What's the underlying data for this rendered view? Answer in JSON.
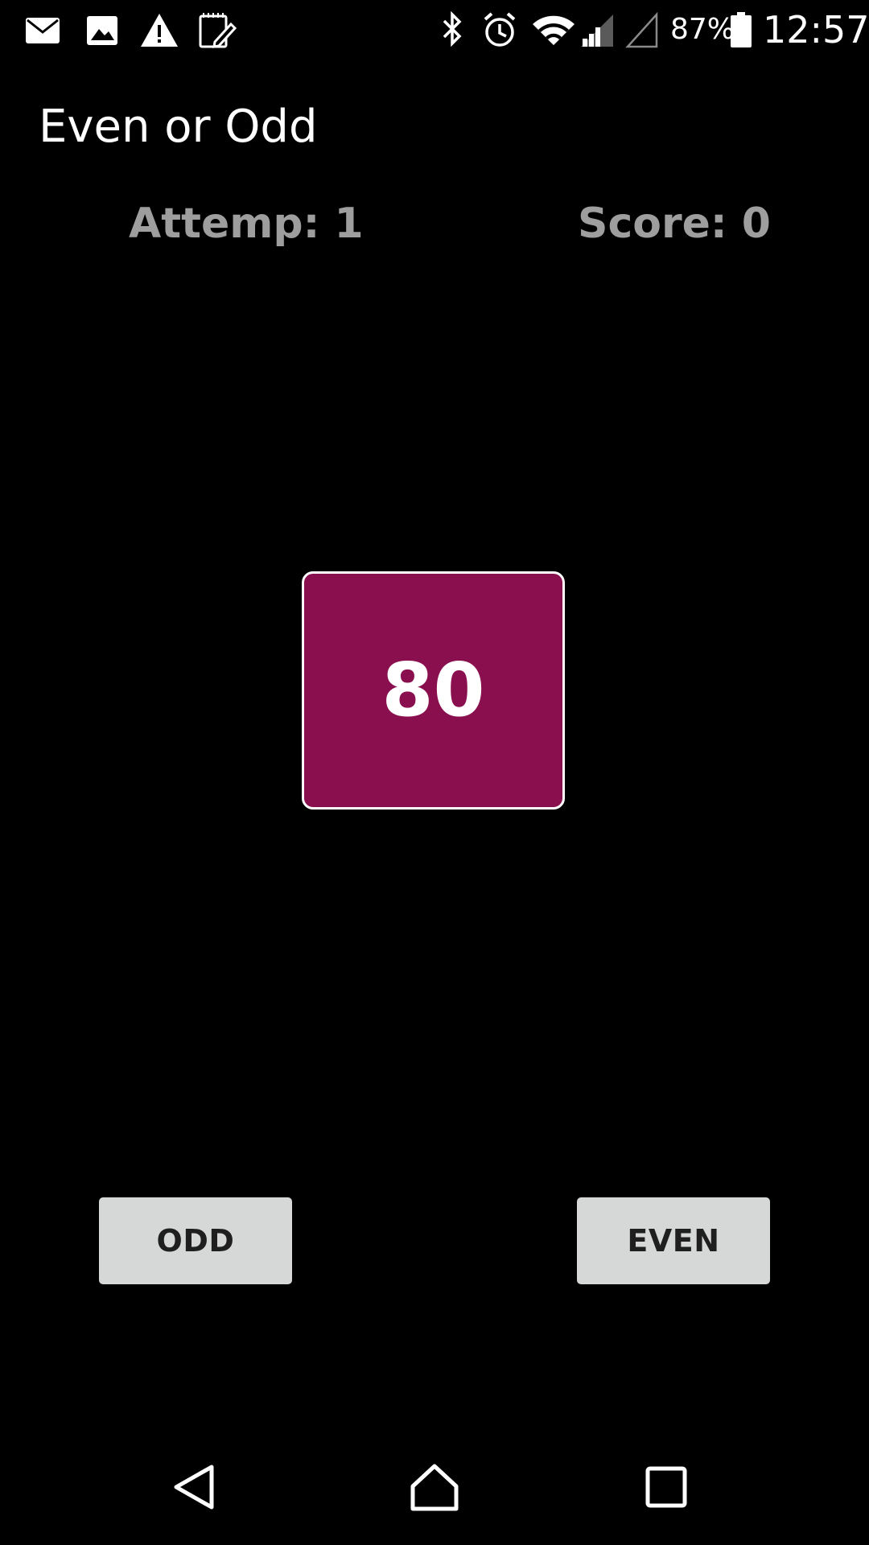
{
  "status_bar": {
    "icons": [
      "mail-icon",
      "image-icon",
      "warning-icon",
      "notes-icon",
      "bluetooth-icon",
      "alarm-icon",
      "wifi-icon",
      "cell-signal-icon",
      "no-signal-icon",
      "battery-icon"
    ],
    "battery_percent": "87%",
    "time": "12:57"
  },
  "app": {
    "title": "Even or Odd"
  },
  "stats": {
    "attempt": "Attemp: 1",
    "score": "Score: 0"
  },
  "card": {
    "number": "80",
    "color": "#8a0f4e"
  },
  "buttons": {
    "odd_label": "ODD",
    "even_label": "EVEN"
  },
  "nav": {
    "icons": [
      "back-icon",
      "home-icon",
      "recents-icon"
    ]
  }
}
